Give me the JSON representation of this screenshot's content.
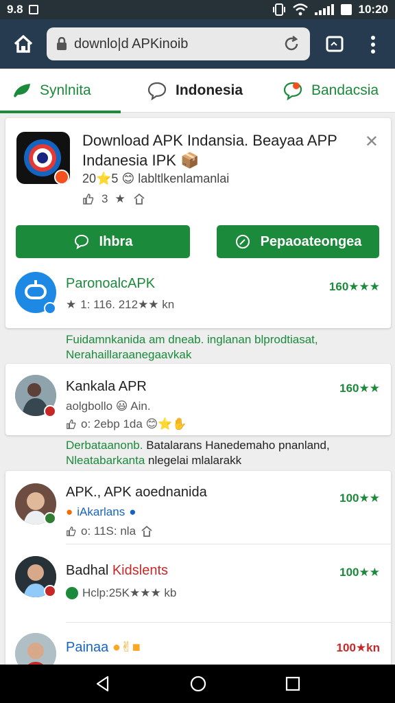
{
  "status_bar": {
    "left_text": "9.8",
    "time": "10:20"
  },
  "browser": {
    "url": "downlo|d APKinoib"
  },
  "tabs": [
    {
      "label": "Synlnita",
      "icon": "leaf-icon"
    },
    {
      "label": "Indonesia",
      "icon": "chat-bubble-icon"
    },
    {
      "label": "Bandacsia",
      "icon": "chat-alert-icon"
    }
  ],
  "featured": {
    "title": "Download APK Indansia. Beayaa APP Indanesia IPK 📦",
    "meta": "20⭐5 😊 labltlkenlamanlai",
    "likes": "3",
    "button_left": "Ihbra",
    "button_right": "Pepaoateongea",
    "item": {
      "name": "ParonoalcAPK",
      "sub": "1: 116. 212★★ kn",
      "rating": "160★★★"
    }
  },
  "desc1": {
    "line1": "Fuidamnkanida am dneab. inglanan blprodtiasat,",
    "line2": "Nerahaillaraanegaavkak"
  },
  "item2": {
    "name": "Kankala APR",
    "sub1": "aolgbollo 😃 Ain.",
    "sub2": "o: 2ebp 1da 😊⭐✋",
    "rating": "160★★"
  },
  "desc2": {
    "line1_green": "Derbataanonb.",
    "line1_rest": " Batalarans Hanedemaho pnanland,",
    "line2_green": "Nleatabarkanta",
    "line2_rest": " nlegelai mlalarakk"
  },
  "list": [
    {
      "name": "APK., APK aoednanida",
      "sub1": "iAkarlans",
      "sub2": "o: 11S: nla",
      "rating": "100★★"
    },
    {
      "name_a": "Badhal",
      "name_b": "Kidslents",
      "sub": "Hclp:25K★★★ kb",
      "rating": "100★★"
    },
    {
      "name": "Painaa",
      "rating": "100★kn"
    }
  ],
  "colors": {
    "accent": "#1b8a3a",
    "toolbar": "#263b4f",
    "red": "#c62828"
  }
}
